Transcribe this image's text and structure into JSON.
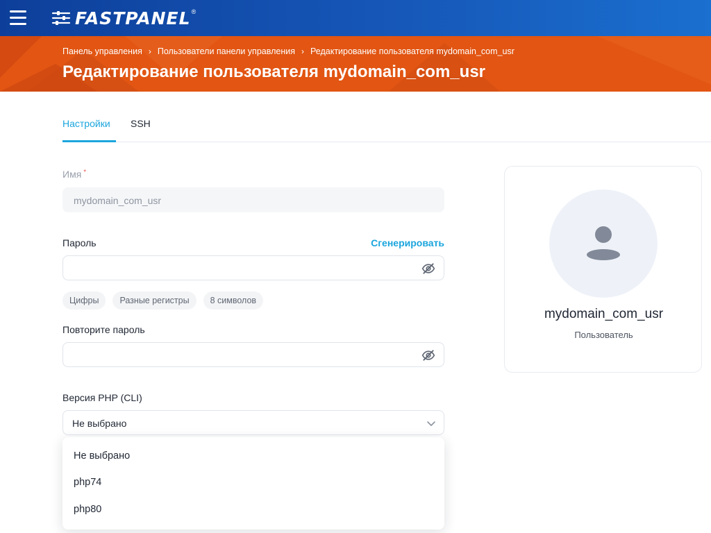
{
  "topbar": {
    "menu_icon": "hamburger-menu-icon",
    "logo_text": "FASTPANEL",
    "logo_reg": "®",
    "colors": {
      "bar_start": "#0d3f9a",
      "bar_end": "#1a6fcf"
    }
  },
  "header": {
    "breadcrumb": [
      "Панель управления",
      "Пользователи панели управления",
      "Редактирование пользователя mydomain_com_usr"
    ],
    "title": "Редактирование пользователя mydomain_com_usr",
    "color": "#e25512"
  },
  "tabs": [
    {
      "label": "Настройки",
      "active": true
    },
    {
      "label": "SSH",
      "active": false
    }
  ],
  "form": {
    "name": {
      "label": "Имя",
      "required_mark": "*",
      "value": "mydomain_com_usr"
    },
    "password": {
      "label": "Пароль",
      "generate_label": "Сгенерировать",
      "value": "",
      "icon": "eye-off-icon"
    },
    "requirements": [
      "Цифры",
      "Разные регистры",
      "8 символов"
    ],
    "password_repeat": {
      "label": "Повторите пароль",
      "value": "",
      "icon": "eye-off-icon"
    },
    "php_version": {
      "label": "Версия PHP (CLI)",
      "selected": "Не выбрано",
      "options": [
        "Не выбрано",
        "php74",
        "php80"
      ]
    }
  },
  "profile_card": {
    "username": "mydomain_com_usr",
    "role": "Пользователь",
    "avatar_icon": "user-icon"
  },
  "accent_color": "#1ba5dd"
}
